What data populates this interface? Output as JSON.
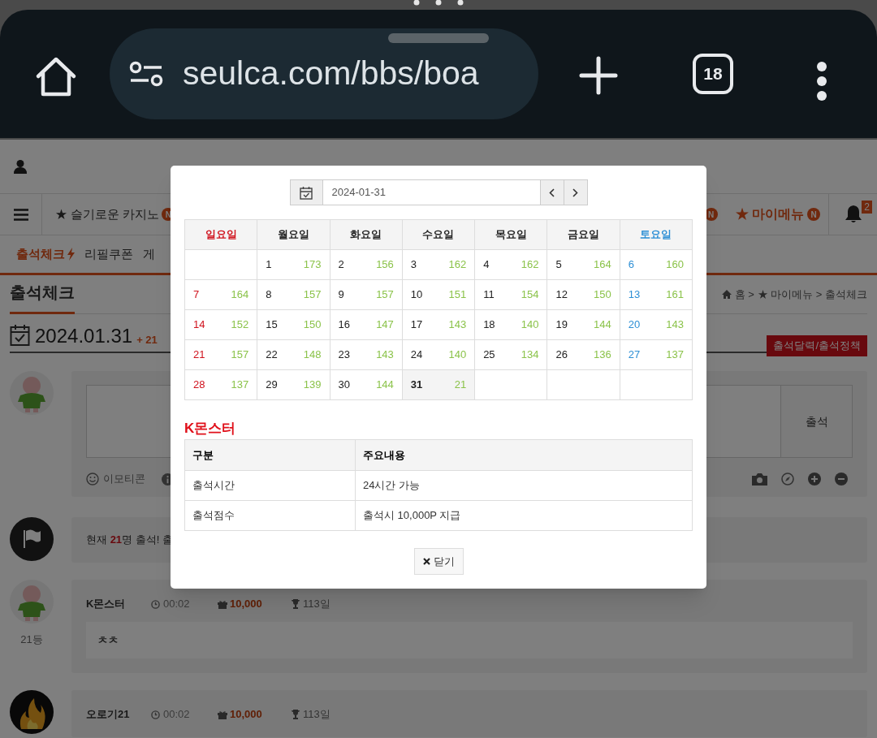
{
  "browser": {
    "url": "seulca.com/bbs/boa",
    "tab_count": "18"
  },
  "page": {
    "nav": {
      "site_item": "★ 슬기로운 카지노",
      "site_badge": "N",
      "right_badge": "N",
      "mymenu": "★ 마이메뉴",
      "mymenu_badge": "N",
      "bell_count": "2"
    },
    "tabs": [
      {
        "label": "출석체크",
        "selected": true
      },
      {
        "label": "리필쿠폰",
        "selected": false
      },
      {
        "label": "게",
        "selected": false
      }
    ],
    "title": "출석체크",
    "breadcrumb": "홈 > ★ 마이메뉴 > 출석체크",
    "date": "2024.01.31",
    "count": "+ 21",
    "calendar_button": "출석달력/출석정책",
    "form": {
      "submit": "출석",
      "emoticon": "이모티콘"
    },
    "notice": "현재 **21**명 출석! 출",
    "entries": [
      {
        "kind": "figure",
        "name": "K몬스터",
        "time": "00:02",
        "points": "10,000",
        "days": "113일",
        "rank": "21등",
        "comment": "ㅊㅊ"
      },
      {
        "kind": "fire",
        "name": "오로기21",
        "time": "00:02",
        "points": "10,000",
        "days": "113일"
      }
    ]
  },
  "modal": {
    "date": "2024-01-31",
    "weekdays": [
      {
        "label": "일요일",
        "kind": "sunday"
      },
      {
        "label": "월요일",
        "kind": "weekday"
      },
      {
        "label": "화요일",
        "kind": "weekday"
      },
      {
        "label": "수요일",
        "kind": "weekday"
      },
      {
        "label": "목요일",
        "kind": "weekday"
      },
      {
        "label": "금요일",
        "kind": "weekday"
      },
      {
        "label": "토요일",
        "kind": "saturday"
      }
    ],
    "weeks": [
      [
        {
          "kind": "blank"
        },
        {
          "day": "1",
          "count": "173",
          "selected": false
        },
        {
          "day": "2",
          "count": "156",
          "selected": false
        },
        {
          "day": "3",
          "count": "162",
          "selected": false
        },
        {
          "day": "4",
          "count": "162",
          "selected": false
        },
        {
          "day": "5",
          "count": "164",
          "selected": false
        },
        {
          "day": "6",
          "count": "160",
          "selected": false
        }
      ],
      [
        {
          "day": "7",
          "count": "164",
          "selected": false
        },
        {
          "day": "8",
          "count": "157",
          "selected": false
        },
        {
          "day": "9",
          "count": "157",
          "selected": false
        },
        {
          "day": "10",
          "count": "151",
          "selected": false
        },
        {
          "day": "11",
          "count": "154",
          "selected": false
        },
        {
          "day": "12",
          "count": "150",
          "selected": false
        },
        {
          "day": "13",
          "count": "161",
          "selected": false
        }
      ],
      [
        {
          "day": "14",
          "count": "152",
          "selected": false
        },
        {
          "day": "15",
          "count": "150",
          "selected": false
        },
        {
          "day": "16",
          "count": "147",
          "selected": false
        },
        {
          "day": "17",
          "count": "143",
          "selected": false
        },
        {
          "day": "18",
          "count": "140",
          "selected": false
        },
        {
          "day": "19",
          "count": "144",
          "selected": false
        },
        {
          "day": "20",
          "count": "143",
          "selected": false
        }
      ],
      [
        {
          "day": "21",
          "count": "157",
          "selected": false
        },
        {
          "day": "22",
          "count": "148",
          "selected": false
        },
        {
          "day": "23",
          "count": "143",
          "selected": false
        },
        {
          "day": "24",
          "count": "140",
          "selected": false
        },
        {
          "day": "25",
          "count": "134",
          "selected": false
        },
        {
          "day": "26",
          "count": "136",
          "selected": false
        },
        {
          "day": "27",
          "count": "137",
          "selected": false
        }
      ],
      [
        {
          "day": "28",
          "count": "137",
          "selected": false
        },
        {
          "day": "29",
          "count": "139",
          "selected": false
        },
        {
          "day": "30",
          "count": "144",
          "selected": false
        },
        {
          "day": "31",
          "count": "21",
          "selected": true
        },
        {
          "kind": "blank"
        },
        {
          "kind": "blank"
        },
        {
          "kind": "blank"
        }
      ]
    ],
    "section_title": "K몬스터",
    "info_table": {
      "columns": [
        "구분",
        "주요내용"
      ],
      "rows": [
        [
          "출석시간",
          "24시간 가능"
        ],
        [
          "출석점수",
          "출석시 10,000P 지급"
        ]
      ]
    },
    "close": "닫기"
  }
}
